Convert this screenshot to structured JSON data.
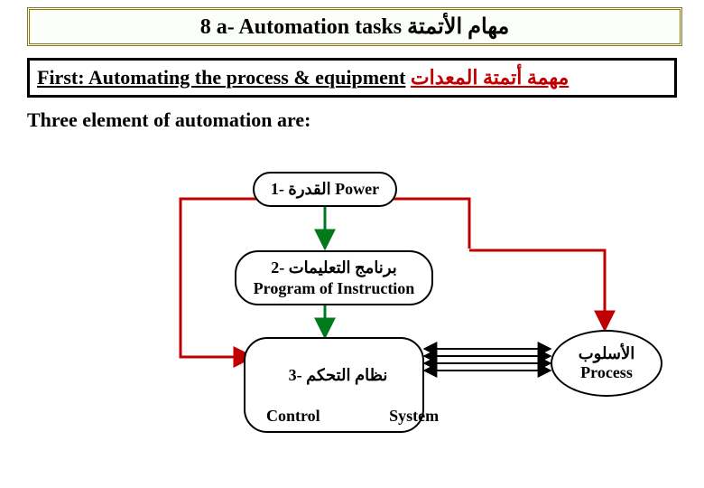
{
  "title_box": "8 a- Automation tasks مهام الأتمتة",
  "subtitle": {
    "english": "First: Automating the process & equipment",
    "arabic": "مهمة أتمتة المعدات"
  },
  "body_text": "Three  element of automation are:",
  "nodes": {
    "power": {
      "ar": "1- القدرة",
      "en": "Power"
    },
    "program": {
      "ar": "2- برنامج التعليمات",
      "en": "Program of Instruction"
    },
    "control": {
      "ar": "3- نظام التحكم",
      "en": "Control                 System"
    },
    "process": {
      "ar": "الأسلوب",
      "en": "Process"
    }
  }
}
